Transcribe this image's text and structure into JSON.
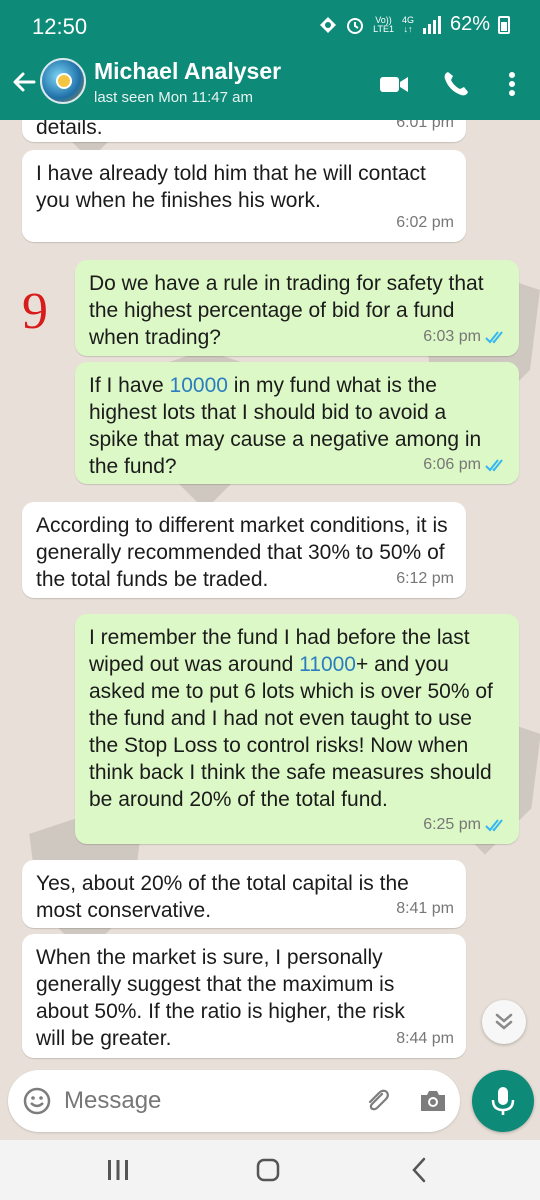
{
  "status_bar": {
    "time": "12:50",
    "volte": "Vo))",
    "lte": "LTE1",
    "network": "4G",
    "battery": "62%"
  },
  "header": {
    "contact_name": "Michael Analyser",
    "last_seen": "last seen Mon 11:47 am"
  },
  "annotation": "9",
  "messages": [
    {
      "dir": "in",
      "text": "details.",
      "time": "6:01 pm"
    },
    {
      "dir": "in",
      "text": "I have already told him that he will contact you when he finishes his work.",
      "time": "6:02 pm"
    },
    {
      "dir": "out",
      "text": "Do we have a rule in trading for safety that the highest percentage of bid for a fund when trading?",
      "time": "6:03 pm"
    },
    {
      "dir": "out",
      "text_before": "If I have ",
      "highlight": "10000",
      "text_after": " in my fund what is the highest lots that I should bid to avoid a spike that may cause a negative among in the fund?",
      "time": "6:06 pm"
    },
    {
      "dir": "in",
      "text": "According to different market conditions, it is generally recommended that 30% to 50% of the total funds be traded.",
      "time": "6:12 pm"
    },
    {
      "dir": "out",
      "text_before": "I remember the fund I had before the last wiped out was around ",
      "highlight": "11000",
      "text_after": "+ and you asked me to put 6 lots which is over 50% of the fund and I had not even taught to use the Stop Loss to control risks! Now when think back I think the safe measures should be around 20% of the total fund.",
      "time": "6:25 pm"
    },
    {
      "dir": "in",
      "text": "Yes, about 20% of the total capital is the most conservative.",
      "time": "8:41 pm"
    },
    {
      "dir": "in",
      "text": "When the market is sure, I personally generally suggest that the maximum is about 50%. If the ratio is higher, the risk will be greater.",
      "time": "8:44 pm"
    }
  ],
  "input": {
    "placeholder": "Message"
  },
  "colors": {
    "header": "#0e8a78",
    "outgoing": "#dcf8c6",
    "incoming": "#ffffff",
    "read_ticks": "#34b7f1",
    "link_number": "#2a7ec0",
    "annotation": "#d81c1c"
  }
}
